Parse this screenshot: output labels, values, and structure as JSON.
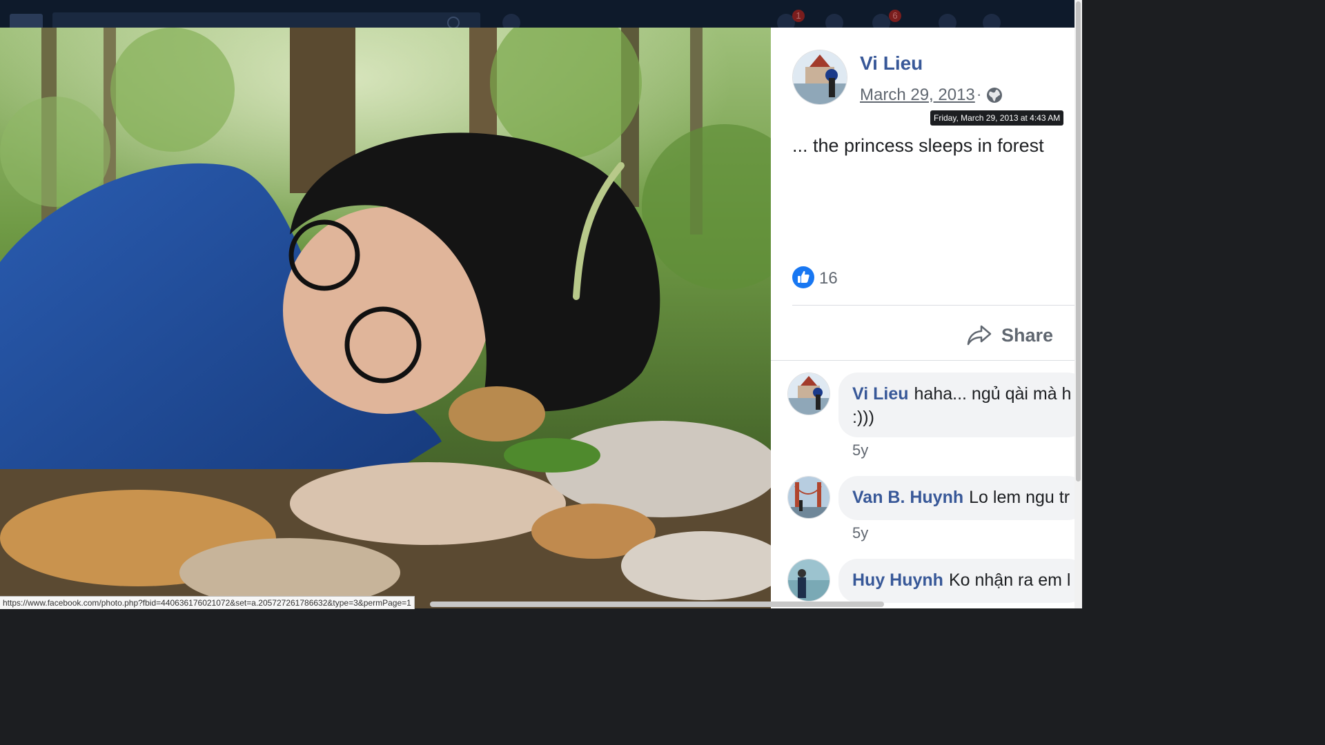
{
  "topbar": {
    "badges": [
      "1",
      "6"
    ]
  },
  "photo": {
    "description_icon": "photo-of-sleeping-girl-in-forest"
  },
  "post": {
    "author": "Vi Lieu",
    "date": "March 29, 2013",
    "separator": "·",
    "full_timestamp": "Friday, March 29, 2013 at 4:43 AM",
    "caption": "... the princess sleeps in forest",
    "like_count": "16",
    "share_label": "Share"
  },
  "comments": [
    {
      "name": "Vi Lieu",
      "text": "haha... ngủ qài mà h",
      "text2": ":)))",
      "time": "5y"
    },
    {
      "name": "Van B. Huynh",
      "text": "Lo lem ngu tr",
      "time": "5y"
    },
    {
      "name": "Huy Huynh",
      "text": "Ko nhận ra em l"
    }
  ],
  "status_bar": {
    "url": "https://www.facebook.com/photo.php?fbid=440636176021072&set=a.205727261786632&type=3&permPage=1"
  },
  "colors": {
    "link": "#385898",
    "like_blue": "#1877f2",
    "tooltip_bg": "#1c1e21"
  }
}
